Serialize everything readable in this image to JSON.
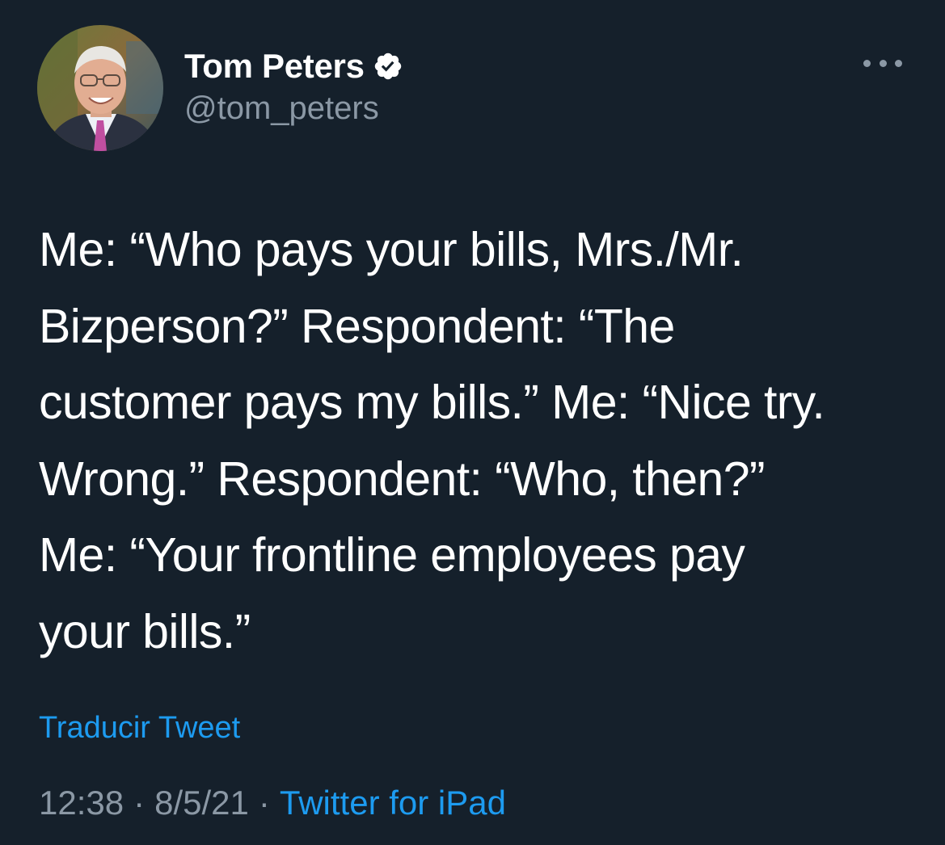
{
  "author": {
    "display_name": "Tom Peters",
    "handle": "@tom_peters",
    "verified": true,
    "verified_icon": "verified-badge-icon"
  },
  "menu_icon": "more-options-icon",
  "tweet": {
    "lines": [
      "Me: “Who pays your bills, Mrs./Mr.",
      "Bizperson?” Respondent: “The",
      "customer pays my bills.” Me: “Nice try.",
      "Wrong.” Respondent: “Who, then?”",
      "Me: “Your frontline employees pay",
      "your bills.”"
    ]
  },
  "translate_label": "Traducir Tweet",
  "meta": {
    "time": "12:38",
    "separator": "·",
    "date": "8/5/21",
    "source": "Twitter for iPad"
  },
  "colors": {
    "background": "#15202b",
    "text": "#ffffff",
    "secondary": "#8b98a5",
    "link": "#1d9bf0"
  }
}
